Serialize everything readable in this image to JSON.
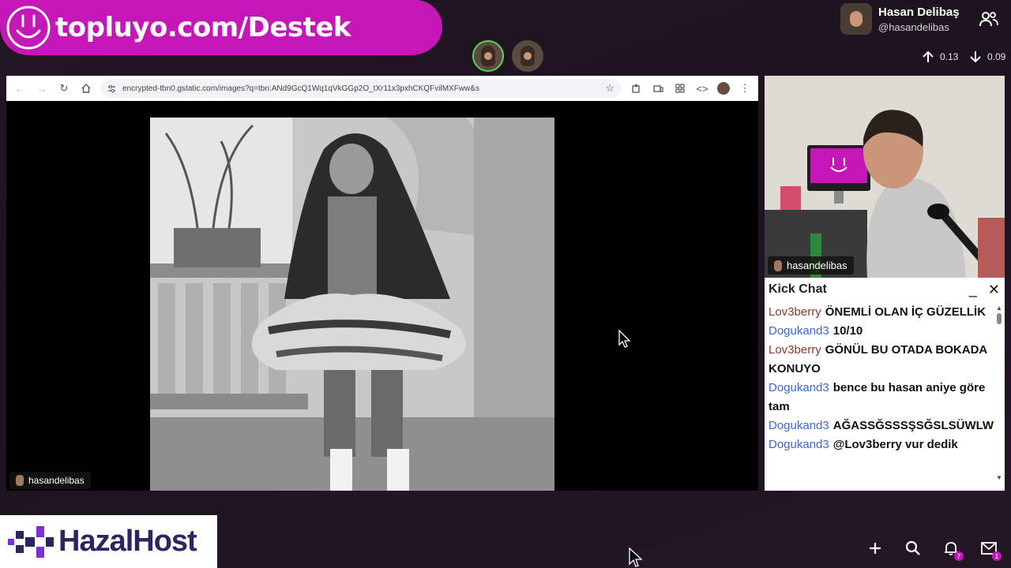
{
  "banner": {
    "text": "topluyo.com/Destek",
    "color": "#c516b8",
    "icon": "smile-logo-icon"
  },
  "viewers_mini": [
    "viewer-avatar-icon",
    "viewer-avatar-icon"
  ],
  "profile": {
    "name": "Hasan Delibaş",
    "handle": "@hasandelibas"
  },
  "network": {
    "upload": "0.13",
    "download": "0.09"
  },
  "browser": {
    "url": "encrypted-tbn0.gstatic.com/images?q=tbn:ANd9GcQ1Wq1qVkGGp2O_tXr11x3pxhCKQFvilMXFww&s",
    "cam_label": "hasandelibas"
  },
  "webcam": {
    "label": "hasandelibas"
  },
  "chat": {
    "title": "Kick Chat",
    "messages": [
      {
        "user": "Lov3berry",
        "user_color": "#8a3a2a",
        "text": "ÖNEMLİ OLAN İÇ GÜZELLİK"
      },
      {
        "user": "Dogukand3",
        "user_color": "#3c66d8",
        "text": "10/10"
      },
      {
        "user": "Lov3berry",
        "user_color": "#8a3a2a",
        "text": "GÖNÜL BU OTADA BOKADA KONUYO"
      },
      {
        "user": "Dogukand3",
        "user_color": "#3c66d8",
        "text": "bence bu hasan aniye göre tam"
      },
      {
        "user": "Dogukand3",
        "user_color": "#3c66d8",
        "text": "AĞASSĞSSSŞSĞSLSÜWLWİWLEŞS"
      },
      {
        "user": "Dogukand3",
        "user_color": "#3c66d8",
        "text": "@Lov3berry vur dedik"
      }
    ]
  },
  "sponsor": {
    "text": "HazalHost",
    "color": "#2a2660"
  },
  "bottom_bar": {
    "notification_count": "7",
    "message_count": "1"
  }
}
